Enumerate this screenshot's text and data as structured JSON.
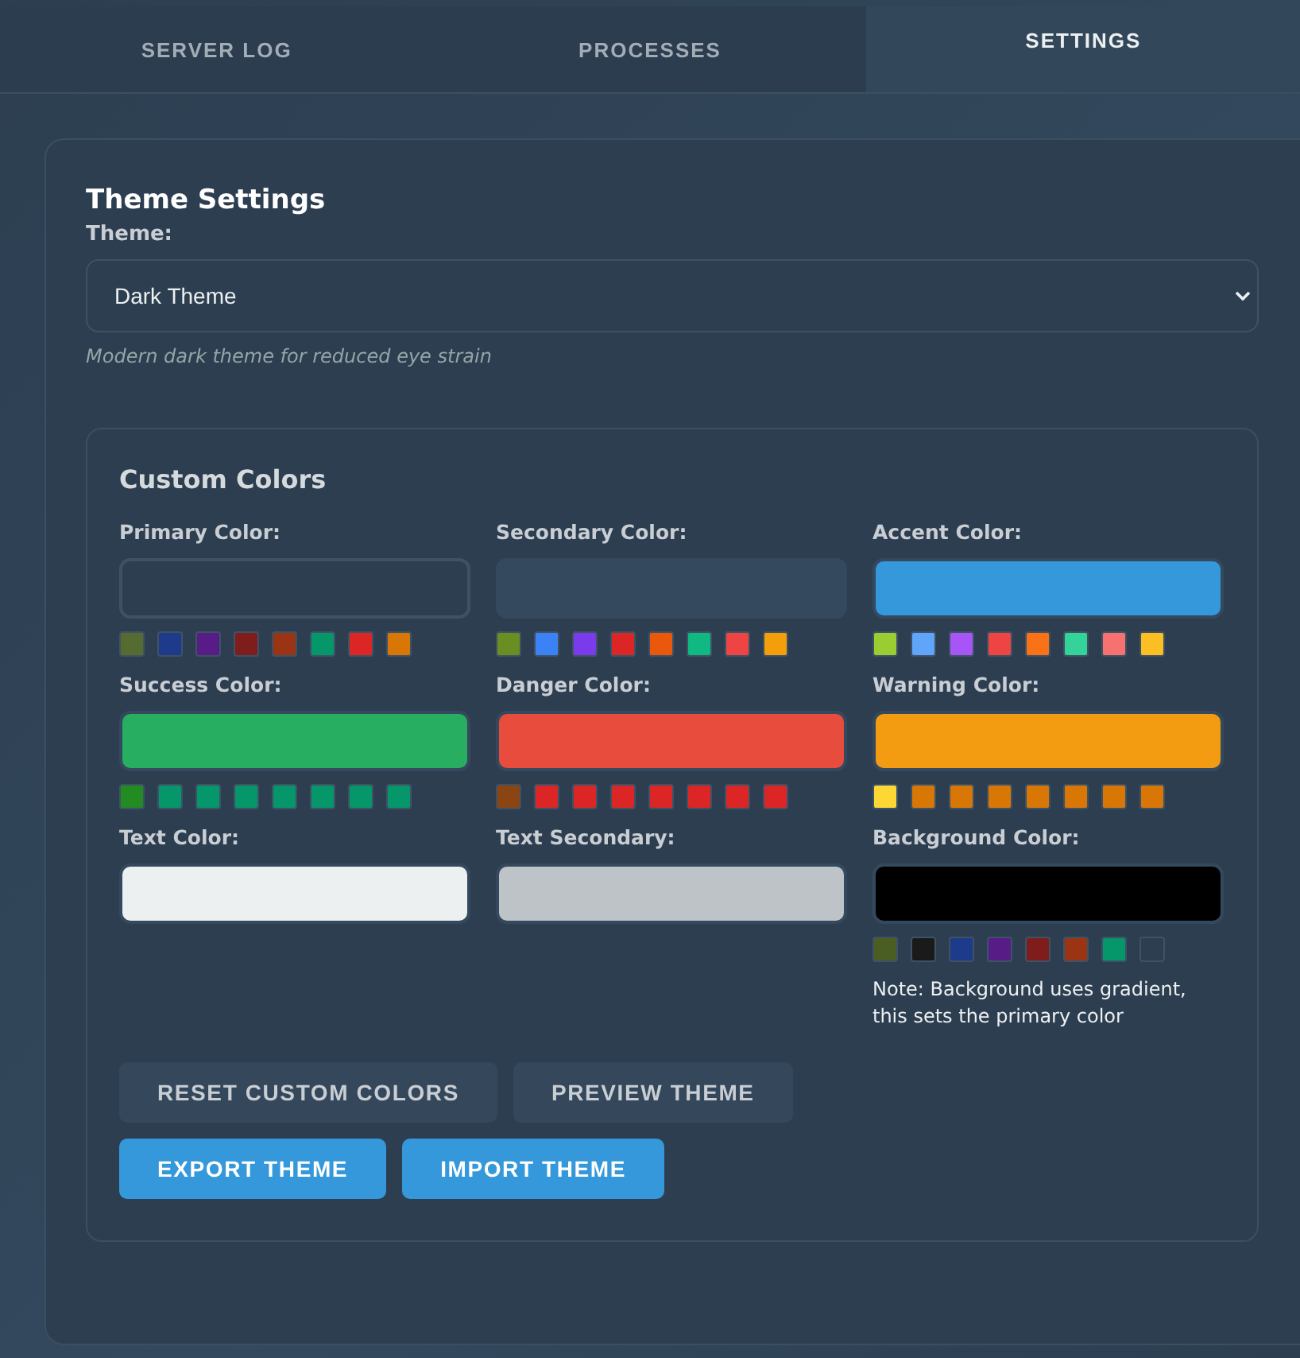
{
  "tabs": [
    {
      "label": "SERVER LOG",
      "selected": false
    },
    {
      "label": "PROCESSES",
      "selected": false
    },
    {
      "label": "SETTINGS",
      "selected": true
    }
  ],
  "theme_settings": {
    "title": "Theme Settings",
    "theme_label": "Theme:",
    "theme_value": "Dark Theme",
    "theme_description": "Modern dark theme for reduced eye strain"
  },
  "custom_colors": {
    "title": "Custom Colors",
    "fields": [
      {
        "label": "Primary Color:",
        "color": "#2c3e50",
        "presets": [
          {
            "color": "#556b2f"
          },
          {
            "color": "#1e3a8a"
          },
          {
            "color": "#581c87"
          },
          {
            "color": "#7f1d1d"
          },
          {
            "color": "#9a3412"
          },
          {
            "color": "#059669"
          },
          {
            "color": "#dc2626"
          },
          {
            "color": "#d97706"
          }
        ]
      },
      {
        "label": "Secondary Color:",
        "color": "#34495e",
        "presets": [
          {
            "color": "#6b8e23"
          },
          {
            "color": "#3b82f6"
          },
          {
            "color": "#7c3aed"
          },
          {
            "color": "#dc2626"
          },
          {
            "color": "#ea580c"
          },
          {
            "color": "#10b981"
          },
          {
            "color": "#ef4444"
          },
          {
            "color": "#f59e0b"
          }
        ]
      },
      {
        "label": "Accent Color:",
        "color": "#3498db",
        "presets": [
          {
            "color": "#9acd32"
          },
          {
            "color": "#60a5fa"
          },
          {
            "color": "#a855f7"
          },
          {
            "color": "#ef4444"
          },
          {
            "color": "#f97316"
          },
          {
            "color": "#34d399"
          },
          {
            "color": "#f87171"
          },
          {
            "color": "#fbbf24"
          }
        ]
      },
      {
        "label": "Success Color:",
        "color": "#27ae60",
        "presets": [
          {
            "color": "#228b22"
          },
          {
            "color": "#059669"
          },
          {
            "color": "#059669"
          },
          {
            "color": "#059669"
          },
          {
            "color": "#059669"
          },
          {
            "color": "#059669"
          },
          {
            "color": "#059669"
          },
          {
            "color": "#059669"
          }
        ]
      },
      {
        "label": "Danger Color:",
        "color": "#e74c3c",
        "presets": [
          {
            "color": "#8b4513"
          },
          {
            "color": "#dc2626"
          },
          {
            "color": "#dc2626"
          },
          {
            "color": "#dc2626"
          },
          {
            "color": "#dc2626"
          },
          {
            "color": "#dc2626"
          },
          {
            "color": "#dc2626"
          },
          {
            "color": "#dc2626"
          }
        ]
      },
      {
        "label": "Warning Color:",
        "color": "#f39c12",
        "presets": [
          {
            "color": "#fdd835"
          },
          {
            "color": "#d97706"
          },
          {
            "color": "#d97706"
          },
          {
            "color": "#d97706"
          },
          {
            "color": "#d97706"
          },
          {
            "color": "#d97706"
          },
          {
            "color": "#d97706"
          },
          {
            "color": "#d97706"
          }
        ]
      },
      {
        "label": "Text Color:",
        "color": "#ecf0f1"
      },
      {
        "label": "Text Secondary:",
        "color": "#bdc3c7"
      },
      {
        "label": "Background Color:",
        "color": "#000000",
        "presets": [
          {
            "color": "#4a5d23"
          },
          {
            "color": "#1a1a1a"
          },
          {
            "color": "#1e3a8a"
          },
          {
            "color": "#581c87"
          },
          {
            "color": "#7f1d1d"
          },
          {
            "color": "#9a3412"
          },
          {
            "color": "#059669"
          },
          {
            "color": "#2c3e50"
          }
        ],
        "note": "Note: Background uses gradient, this sets the primary color"
      }
    ],
    "buttons": [
      {
        "label": "RESET CUSTOM COLORS",
        "kind": "secondary"
      },
      {
        "label": "PREVIEW THEME",
        "kind": "secondary"
      },
      {
        "label": "EXPORT THEME",
        "kind": "primary"
      },
      {
        "label": "IMPORT THEME",
        "kind": "primary"
      }
    ]
  }
}
